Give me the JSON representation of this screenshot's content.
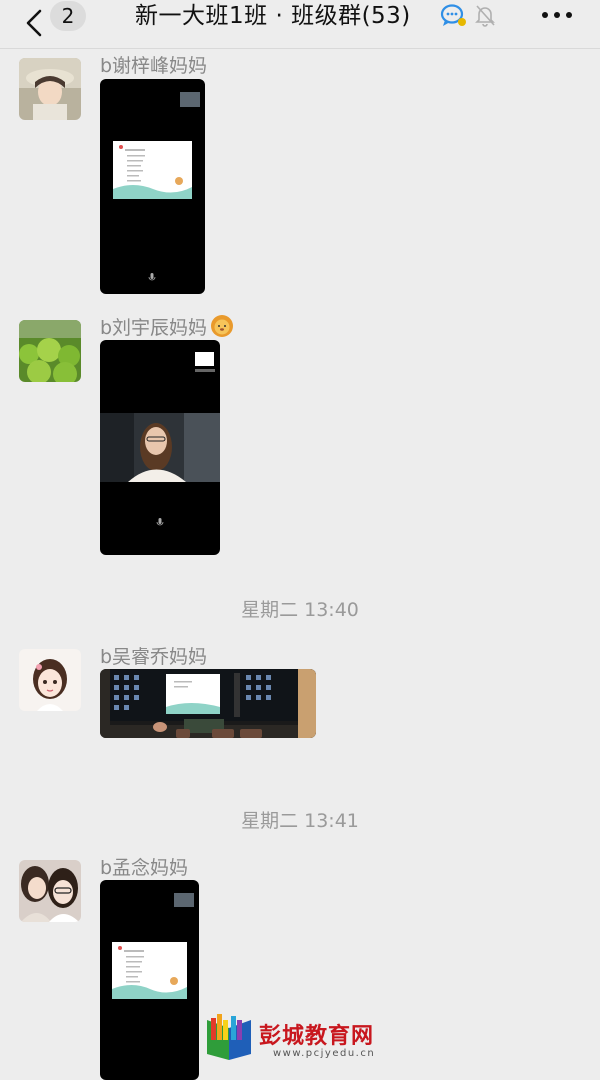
{
  "header": {
    "back_badge": "2",
    "title": "新一大班1班 · 班级群(53)"
  },
  "icons": {
    "back": "chevron-left-icon",
    "chat": "chat-bubble-icon",
    "mute": "bell-mute-icon",
    "more": "more-dots-icon",
    "emoji": "lion-face-emoji"
  },
  "messages": [
    {
      "sender": "b谢梓峰妈妈",
      "type": "image"
    },
    {
      "sender": "b刘宇辰妈妈",
      "type": "image"
    },
    {
      "timestamp": "星期二 13:40"
    },
    {
      "sender": "b吴睿乔妈妈",
      "type": "image"
    },
    {
      "timestamp": "星期二 13:41"
    },
    {
      "sender": "b孟念妈妈",
      "type": "image"
    }
  ],
  "watermark": {
    "name": "彭城教育网",
    "url": "www.pcjyedu.cn"
  },
  "colors": {
    "background": "#ededed",
    "sender_text": "#888888",
    "timestamp_text": "#9a9a9a",
    "watermark_red": "#c8171e",
    "chat_icon_blue": "#2f8fe6"
  }
}
